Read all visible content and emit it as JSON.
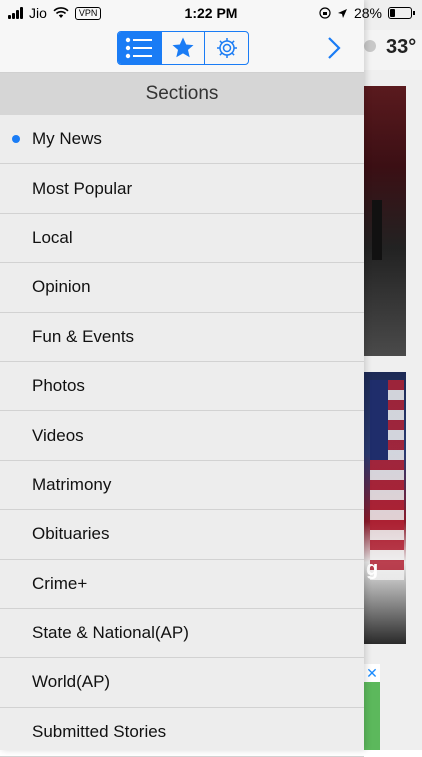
{
  "status_bar": {
    "carrier": "Jio",
    "vpn": "VPN",
    "time": "1:22 PM",
    "battery_percent": "28%",
    "battery_level": 0.28
  },
  "background": {
    "temperature": "33°",
    "overlay_text": "g"
  },
  "toolbar": {
    "segments": [
      {
        "icon": "list-icon",
        "active": true
      },
      {
        "icon": "star-icon",
        "active": false
      },
      {
        "icon": "gear-icon",
        "active": false
      }
    ],
    "next_icon": "chevron-right-icon",
    "accent_color": "#1a7cf5"
  },
  "sections": {
    "title": "Sections",
    "items": [
      {
        "label": "My News",
        "selected": true
      },
      {
        "label": "Most Popular"
      },
      {
        "label": "Local"
      },
      {
        "label": "Opinion"
      },
      {
        "label": "Fun & Events"
      },
      {
        "label": "Photos"
      },
      {
        "label": "Videos"
      },
      {
        "label": "Matrimony"
      },
      {
        "label": "Obituaries"
      },
      {
        "label": "Crime+"
      },
      {
        "label": "State & National(AP)"
      },
      {
        "label": "World(AP)"
      },
      {
        "label": "Submitted Stories"
      }
    ]
  }
}
